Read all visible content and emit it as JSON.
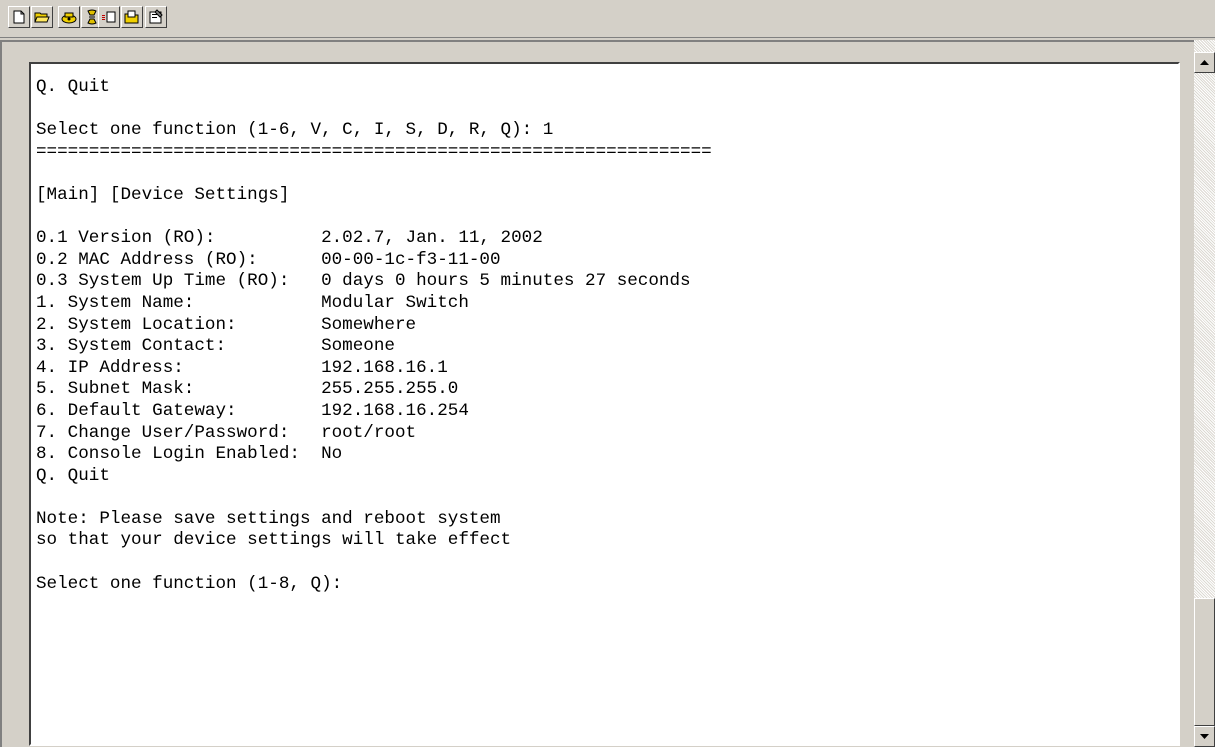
{
  "toolbar": {
    "buttons": [
      {
        "icon": "new-document-icon"
      },
      {
        "icon": "open-folder-icon"
      },
      {
        "icon": "connect-phone-icon"
      },
      {
        "icon": "disconnect-icon"
      },
      {
        "icon": "send-file-icon"
      },
      {
        "icon": "receive-file-icon"
      },
      {
        "icon": "properties-icon"
      }
    ]
  },
  "terminal": {
    "lines": [
      "Q. Quit",
      "",
      "Select one function (1-6, V, C, I, S, D, R, Q): 1",
      "================================================================",
      "",
      "[Main] [Device Settings]",
      "",
      "0.1 Version (RO):          2.02.7, Jan. 11, 2002",
      "0.2 MAC Address (RO):      00-00-1c-f3-11-00",
      "0.3 System Up Time (RO):   0 days 0 hours 5 minutes 27 seconds",
      "1. System Name:            Modular Switch",
      "2. System Location:        Somewhere",
      "3. System Contact:         Someone",
      "4. IP Address:             192.168.16.1",
      "5. Subnet Mask:            255.255.255.0",
      "6. Default Gateway:        192.168.16.254",
      "7. Change User/Password:   root/root",
      "8. Console Login Enabled:  No",
      "Q. Quit",
      "",
      "Note: Please save settings and reboot system",
      "so that your device settings will take effect",
      "",
      "Select one function (1-8, Q):"
    ]
  },
  "scrollbar": {
    "up_icon": "scroll-up-arrow-icon",
    "down_icon": "scroll-down-arrow-icon"
  }
}
